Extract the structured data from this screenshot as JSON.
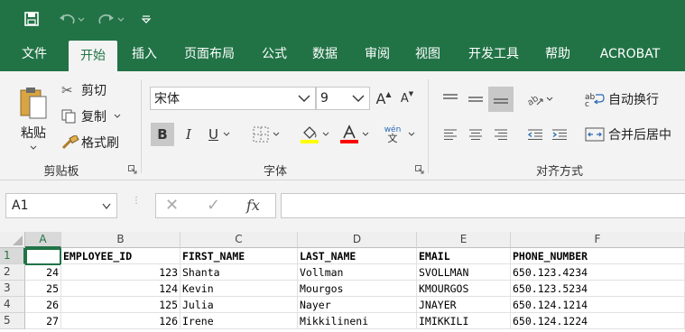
{
  "tabs": [
    "文件",
    "开始",
    "插入",
    "页面布局",
    "公式",
    "数据",
    "审阅",
    "视图",
    "开发工具",
    "帮助",
    "ACROBAT"
  ],
  "clipboard": {
    "paste": "粘贴",
    "cut": "剪切",
    "copy": "复制",
    "format_painter": "格式刷",
    "group": "剪贴板"
  },
  "font": {
    "name": "宋体",
    "size": "9",
    "group": "字体",
    "bold": "B",
    "italic": "I",
    "underline": "U",
    "grow": "A",
    "shrink": "A",
    "phonetic": "wén"
  },
  "alignment": {
    "wrap": "自动换行",
    "merge": "合并后居中",
    "group": "对齐方式"
  },
  "formula_bar": {
    "name_box": "A1",
    "fx": "fx",
    "value": ""
  },
  "colors": {
    "accent": "#217346",
    "fill": "#ffff00",
    "font": "#ff0000"
  },
  "grid": {
    "columns": [
      "A",
      "B",
      "C",
      "D",
      "E",
      "F"
    ],
    "rows": [
      "1",
      "2",
      "3",
      "4",
      "5"
    ],
    "data": [
      [
        "",
        "EMPLOYEE_ID",
        "FIRST_NAME",
        "LAST_NAME",
        "EMAIL",
        "PHONE_NUMBER"
      ],
      [
        "24",
        "123",
        "Shanta",
        "Vollman",
        "SVOLLMAN",
        "650.123.4234"
      ],
      [
        "25",
        "124",
        "Kevin",
        "Mourgos",
        "KMOURGOS",
        "650.123.5234"
      ],
      [
        "26",
        "125",
        "Julia",
        "Nayer",
        "JNAYER",
        "650.124.1214"
      ],
      [
        "27",
        "126",
        "Irene",
        "Mikkilineni",
        "IMIKKILI",
        "650.124.1224"
      ]
    ]
  }
}
